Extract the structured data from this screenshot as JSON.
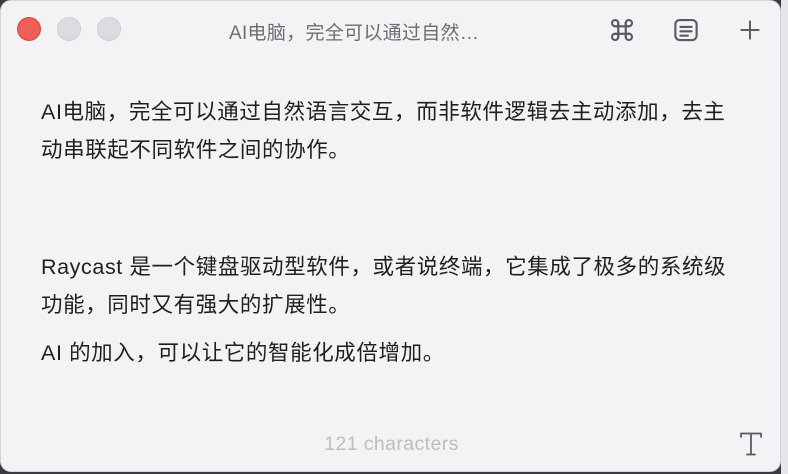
{
  "window": {
    "title": "AI电脑，完全可以通过自然…"
  },
  "toolbar": {
    "command_icon": "command-icon",
    "notes_list_icon": "notes-list-icon",
    "new_note_icon": "plus-icon"
  },
  "note": {
    "paragraphs": [
      "AI电脑，完全可以通过自然语言交互，而非软件逻辑去主动添加，去主动串联起不同软件之间的协作。",
      "Raycast 是一个键盘驱动型软件，或者说终端，它集成了极多的系统级功能，同时又有强大的扩展性。",
      "AI 的加入，可以让它的智能化成倍增加。"
    ]
  },
  "footer": {
    "character_count": "121 characters",
    "format_icon": "text-format-icon"
  },
  "colors": {
    "close": "#ee5f58",
    "inactive_traffic": "#dcdbdf",
    "background": "#f3f2f5",
    "text": "#1f1f22",
    "muted": "#bdbcc1"
  }
}
